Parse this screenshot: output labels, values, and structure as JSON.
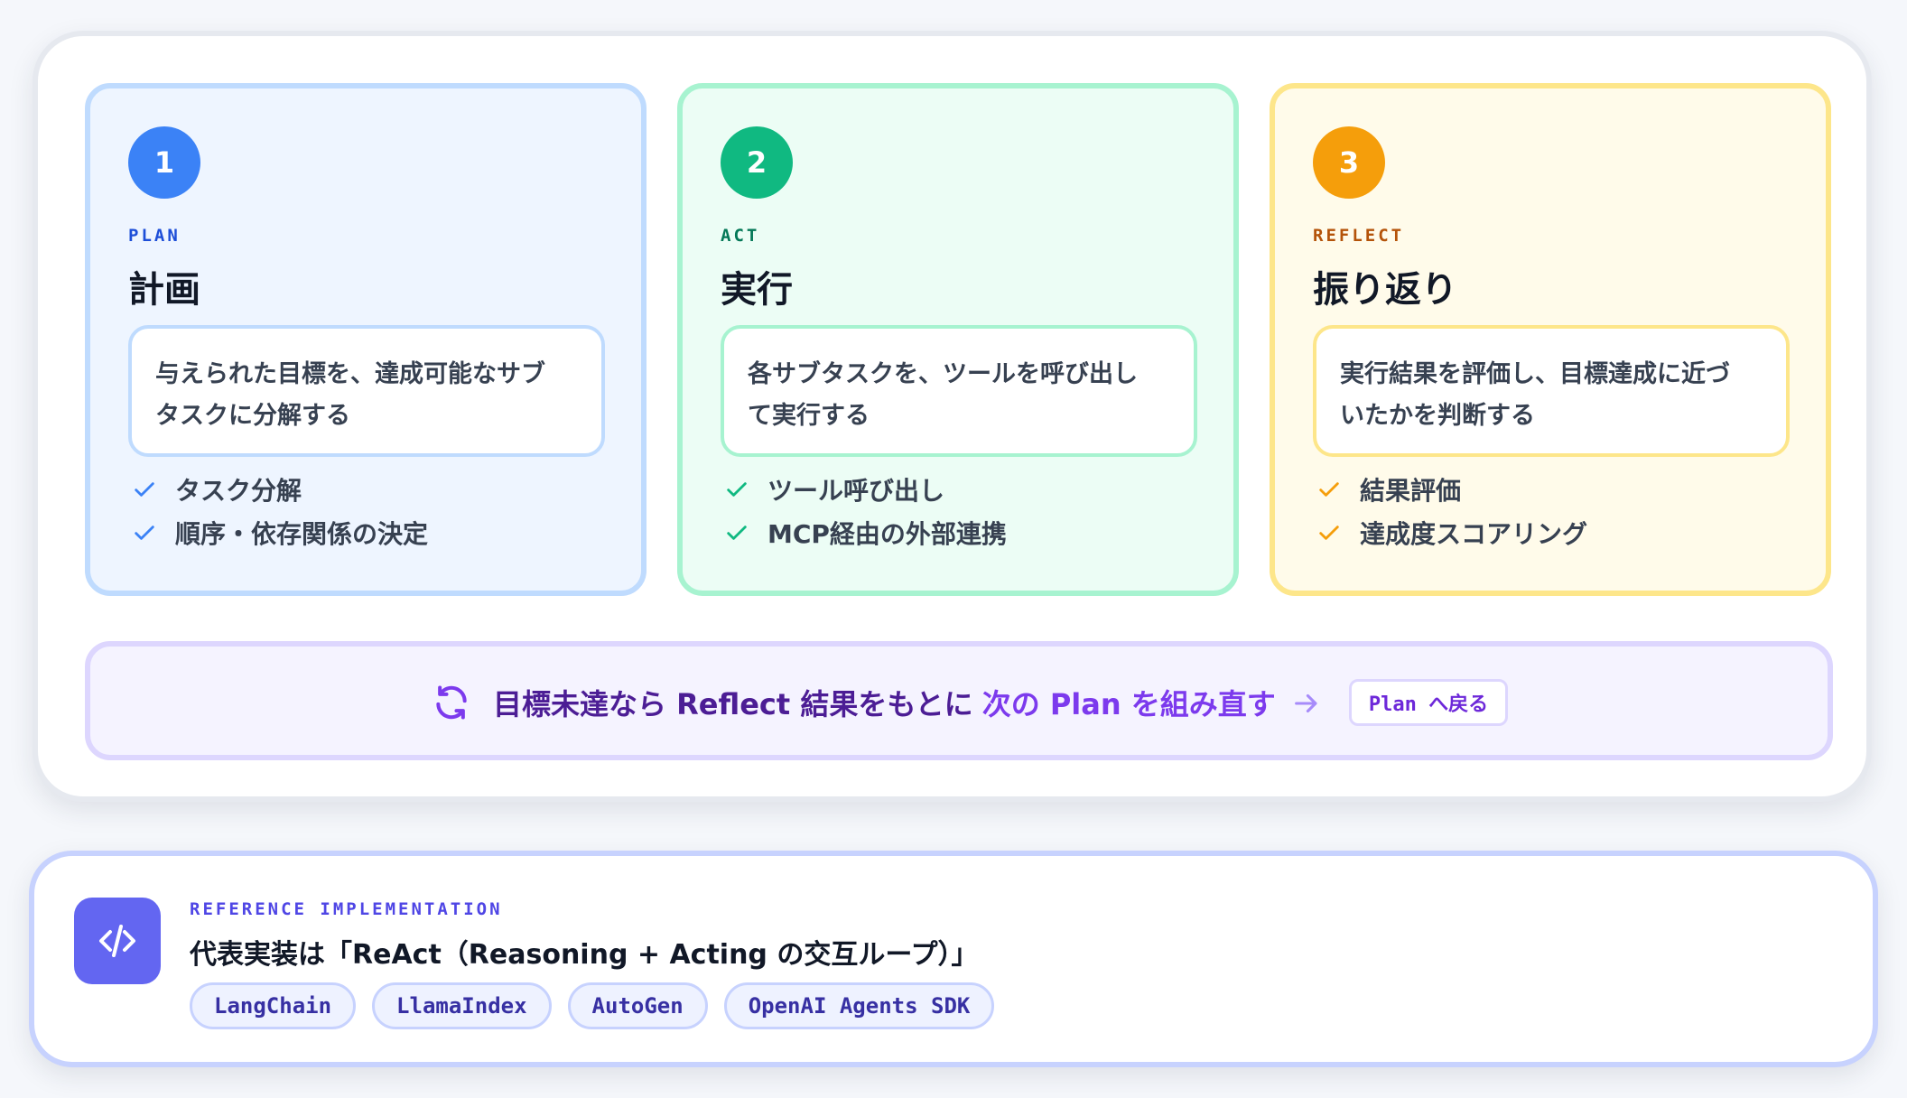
{
  "steps": [
    {
      "number": "1",
      "eyebrow": "PLAN",
      "title": "計画",
      "description_line1": "与えられた目標を、達成可能なサブ",
      "description_line2": "タスクに分解する",
      "bullets": [
        "タスク分解",
        "順序・依存関係の決定"
      ],
      "accent": "#3b82f6"
    },
    {
      "number": "2",
      "eyebrow": "ACT",
      "title": "実行",
      "description_line1": "各サブタスクを、ツールを呼び出し",
      "description_line2": "て実行する",
      "bullets": [
        "ツール呼び出し",
        "MCP経由の外部連携"
      ],
      "accent": "#10b981"
    },
    {
      "number": "3",
      "eyebrow": "REFLECT",
      "title": "振り返り",
      "description_line1": "実行結果を評価し、目標達成に近づ",
      "description_line2": "いたかを判断する",
      "bullets": [
        "結果評価",
        "達成度スコアリング"
      ],
      "accent": "#f59e0b"
    }
  ],
  "loop": {
    "text_a": "目標未達なら Reflect 結果をもとに",
    "text_b": "次の Plan を組み直す",
    "button_label": "Plan へ戻る",
    "accent": "#7c3aed"
  },
  "reference": {
    "eyebrow": "REFERENCE IMPLEMENTATION",
    "title": "代表実装は「ReAct（Reasoning + Acting の交互ループ）」",
    "tags": [
      "LangChain",
      "LlamaIndex",
      "AutoGen",
      "OpenAI Agents SDK"
    ],
    "accent": "#6366f1"
  }
}
